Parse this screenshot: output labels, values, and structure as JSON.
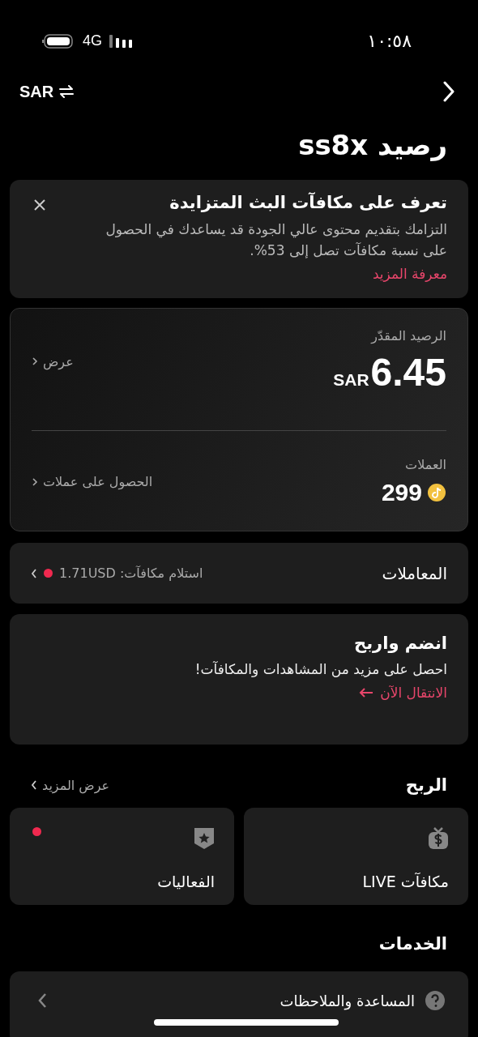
{
  "status_bar": {
    "time": "١٠:٥٨",
    "network": "4G"
  },
  "header": {
    "currency": "SAR",
    "title": "رصيد ss8x"
  },
  "banner": {
    "title": "تعرف على مكافآت البث المتزايدة",
    "body": "التزامك بتقديم محتوى عالي الجودة قد يساعدك في الحصول على نسبة مكافآت تصل إلى 53%.",
    "link": "معرفة المزيد"
  },
  "balance": {
    "label": "الرصيد المقدّر",
    "amount": "6.45",
    "currency": "SAR",
    "link": "عرض"
  },
  "coins": {
    "label": "العملات",
    "amount": "299",
    "link": "الحصول على عملات"
  },
  "transactions": {
    "title": "المعاملات",
    "status": "استلام مكافآت: 1.71USD",
    "unread": true
  },
  "join": {
    "title": "انضم واربح",
    "body": "احصل على مزيد من المشاهدات والمكافآت!",
    "link": "الانتقال الآن"
  },
  "earnings": {
    "title": "الربح",
    "more": "عرض المزيد",
    "tiles": [
      {
        "label": "مكافآت LIVE",
        "kind": "money",
        "unread": false
      },
      {
        "label": "الفعاليات",
        "kind": "badge",
        "unread": true
      }
    ]
  },
  "services": {
    "title": "الخدمات",
    "items": [
      {
        "label": "المساعدة والملاحظات",
        "kind": "help"
      }
    ]
  }
}
